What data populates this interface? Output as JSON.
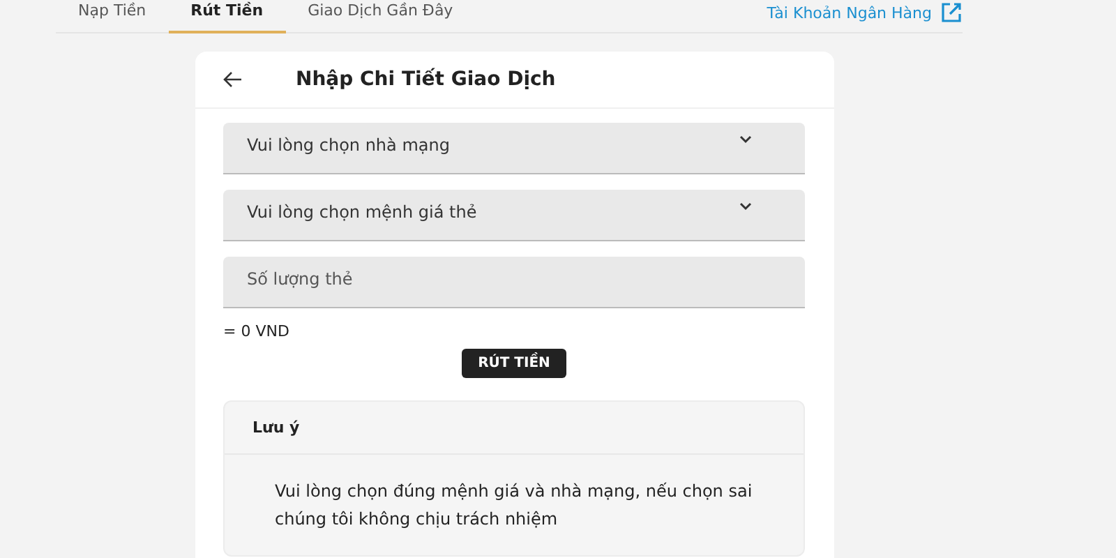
{
  "tabs": [
    {
      "label": "Nạp Tiền",
      "selected": false
    },
    {
      "label": "Rút Tiền",
      "selected": true
    },
    {
      "label": "Giao Dịch Gần Đây",
      "selected": false
    }
  ],
  "bank_link": {
    "label": "Tài Khoản Ngân Hàng"
  },
  "card": {
    "title": "Nhập Chi Tiết Giao Dịch",
    "fields": [
      {
        "kind": "select",
        "placeholder": "Vui lòng chọn nhà mạng"
      },
      {
        "kind": "select",
        "placeholder": "Vui lòng chọn mệnh giá thẻ"
      },
      {
        "kind": "input",
        "placeholder": "Số lượng thẻ"
      }
    ],
    "total": "= 0 VND",
    "submit": "RÚT TIỀN",
    "note": {
      "title": "Lưu ý",
      "text": "Vui lòng chọn đúng mệnh giá và nhà mạng, nếu chọn sai chúng tôi không chịu trách nhiệm"
    }
  }
}
